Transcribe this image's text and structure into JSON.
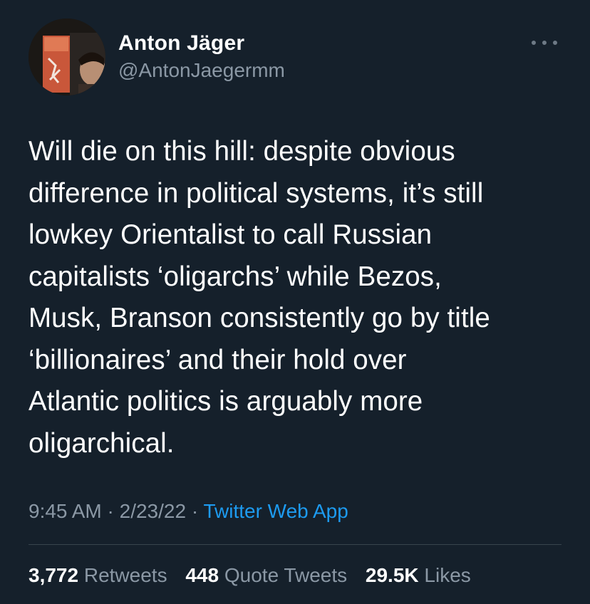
{
  "author": {
    "display_name": "Anton Jäger",
    "handle": "@AntonJaegermm"
  },
  "tweet": {
    "text": "Will die on this hill: despite obvious\ndifference in political systems, it’s still\nlowkey Orientalist to call Russian\ncapitalists ‘oligarchs’ while Bezos,\nMusk, Branson consistently go by title\n‘billionaires’ and their hold over\nAtlantic politics is arguably more\noligarchical."
  },
  "meta": {
    "time": "9:45 AM",
    "separator": "·",
    "date": "2/23/22",
    "source": "Twitter Web App"
  },
  "stats": {
    "retweets": {
      "count": "3,772",
      "label": "Retweets"
    },
    "quotes": {
      "count": "448",
      "label": "Quote Tweets"
    },
    "likes": {
      "count": "29.5K",
      "label": "Likes"
    }
  },
  "icons": {
    "more": "more-horizontal-icon"
  },
  "colors": {
    "background": "#15202b",
    "text": "#ffffff",
    "secondary": "#8b98a5",
    "accent": "#1d9bf0",
    "divider": "#38444d"
  }
}
